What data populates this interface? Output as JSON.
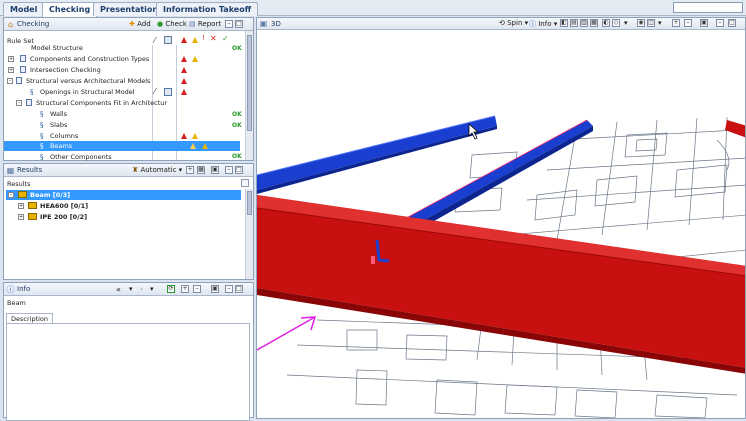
{
  "tabs": [
    "Model",
    "Checking",
    "Presentation",
    "Information Takeoff"
  ],
  "checking": {
    "title": "Checking",
    "add": "Add",
    "check": "Check",
    "report": "Report",
    "ruleset_label": "Rule Set",
    "rows": [
      {
        "label": "Model Structure"
      },
      {
        "label": "Components and Construction Types"
      },
      {
        "label": "Intersection Checking"
      },
      {
        "label": "Structural versus Architectural Models"
      },
      {
        "label": "Openings in Structural Model"
      },
      {
        "label": "Structural Components Fit in Architectur"
      },
      {
        "label": "Walls",
        "ok": "OK"
      },
      {
        "label": "Slabs",
        "ok": "OK"
      },
      {
        "label": "Columns"
      },
      {
        "label": "Beams"
      },
      {
        "label": "Other Components",
        "ok": "OK"
      }
    ],
    "ok_top": "OK"
  },
  "results": {
    "title": "Results",
    "mode": "Automatic",
    "label": "Results",
    "items": [
      {
        "label": "Beam [0/3]"
      },
      {
        "label": "HEA600 [0/1]"
      },
      {
        "label": "IPE 200 [0/2]"
      }
    ]
  },
  "info": {
    "title": "Info",
    "value": "Beam",
    "tab": "Description"
  },
  "view3d": {
    "title": "3D",
    "spin": "Spin",
    "info": "Info"
  },
  "colors": {
    "accent": "#3399ff",
    "beam_red": "#c81010",
    "beam_blue": "#1a3fd0",
    "arrow": "#e020e0"
  }
}
